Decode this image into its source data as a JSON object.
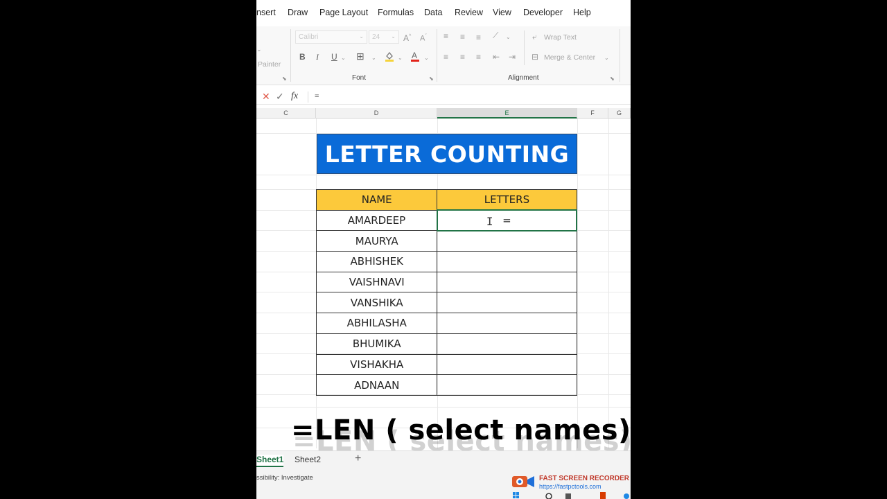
{
  "ribbon_tabs": [
    "nsert",
    "Draw",
    "Page Layout",
    "Formulas",
    "Data",
    "Review",
    "View",
    "Developer",
    "Help"
  ],
  "ribbon": {
    "clipboard_partial_label": "Painter",
    "font_name": "Calibri",
    "font_size": "24",
    "font_group_label": "Font",
    "alignment_group_label": "Alignment",
    "wrap_text_label": "Wrap Text",
    "merge_center_label": "Merge & Center",
    "bold": "B",
    "italic": "I",
    "underline": "U",
    "grow_font": "A",
    "shrink_font": "A"
  },
  "formula_bar": {
    "fx": "fx",
    "value": "="
  },
  "columns": [
    "C",
    "D",
    "E",
    "F",
    "G"
  ],
  "sheet": {
    "banner": "LETTER COUNTING",
    "headers": [
      "NAME",
      "LETTERS"
    ],
    "rows": [
      {
        "name": "AMARDEEP",
        "letters": "="
      },
      {
        "name": "MAURYA",
        "letters": ""
      },
      {
        "name": "ABHISHEK",
        "letters": ""
      },
      {
        "name": "VAISHNAVI",
        "letters": ""
      },
      {
        "name": "VANSHIKA",
        "letters": ""
      },
      {
        "name": "ABHILASHA",
        "letters": ""
      },
      {
        "name": "BHUMIKA",
        "letters": ""
      },
      {
        "name": "VISHAKHA",
        "letters": ""
      },
      {
        "name": "ADNAAN",
        "letters": ""
      }
    ]
  },
  "caption": "=LEN ( select names)",
  "sheet_tabs": [
    "Sheet1",
    "Sheet2"
  ],
  "add_sheet": "+",
  "status": "ssibility: Investigate",
  "watermark": {
    "title": "FAST SCREEN RECORDER",
    "url": "https://fastpctools.com"
  },
  "colors": {
    "banner_bg": "#0a6bd8",
    "header_bg": "#fcc93b",
    "excel_green": "#217346"
  }
}
